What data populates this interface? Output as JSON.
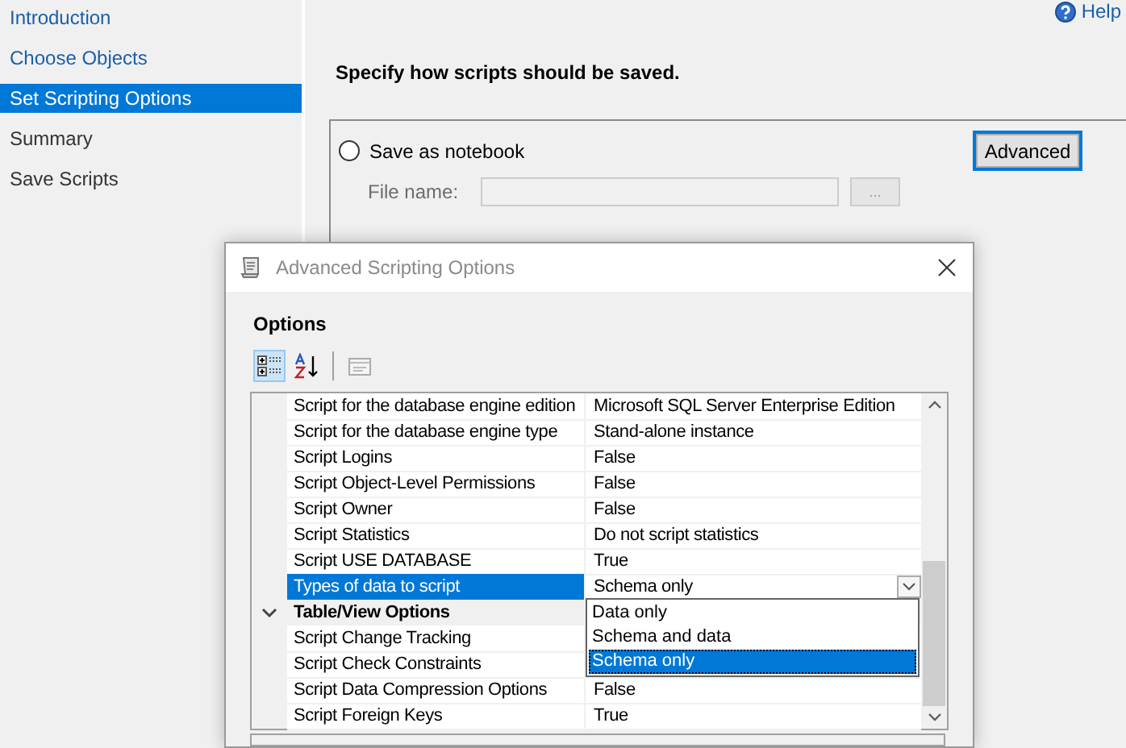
{
  "wizard": {
    "nav": [
      {
        "label": "Introduction",
        "selected": false
      },
      {
        "label": "Choose Objects",
        "selected": false
      },
      {
        "label": "Set Scripting Options",
        "selected": true
      },
      {
        "label": "Summary",
        "selected": false
      },
      {
        "label": "Save Scripts",
        "selected": false
      }
    ],
    "help": "Help",
    "heading": "Specify how scripts should be saved.",
    "save_option": {
      "label": "Save as notebook",
      "selected": false
    },
    "advanced_button": "Advanced",
    "file_name": {
      "label": "File name:",
      "disabled": true
    },
    "browse_button": {
      "label": "...",
      "disabled": true
    }
  },
  "dialog": {
    "title": "Advanced Scripting Options",
    "section": "Options",
    "toolbar": [
      {
        "kind": "categorized",
        "selected": true
      },
      {
        "kind": "alphabetical",
        "selected": false
      },
      {
        "kind": "property-pages",
        "selected": false
      }
    ],
    "rows": [
      {
        "kind": "property",
        "name": "Script for the database engine edition",
        "value": "Microsoft SQL Server Enterprise Edition",
        "selected": false
      },
      {
        "kind": "property",
        "name": "Script for the database engine type",
        "value": "Stand-alone instance",
        "selected": false
      },
      {
        "kind": "property",
        "name": "Script Logins",
        "value": "False",
        "selected": false
      },
      {
        "kind": "property",
        "name": "Script Object-Level Permissions",
        "value": "False",
        "selected": false
      },
      {
        "kind": "property",
        "name": "Script Owner",
        "value": "False",
        "selected": false
      },
      {
        "kind": "property",
        "name": "Script Statistics",
        "value": "Do not script statistics",
        "selected": false
      },
      {
        "kind": "property",
        "name": "Script USE DATABASE",
        "value": "True",
        "selected": false
      },
      {
        "kind": "property",
        "name": "Types of data to script",
        "value": "Schema only",
        "selected": true
      },
      {
        "kind": "category",
        "name": "Table/View Options",
        "expanded": true
      },
      {
        "kind": "property",
        "name": "Script Change Tracking",
        "selected": false
      },
      {
        "kind": "property",
        "name": "Script Check Constraints",
        "selected": false
      },
      {
        "kind": "property",
        "name": "Script Data Compression Options",
        "value": "False",
        "selected": false
      },
      {
        "kind": "property",
        "name": "Script Foreign Keys",
        "value": "True",
        "selected": false
      }
    ],
    "dropdown": [
      {
        "label": "Data only",
        "selected": false
      },
      {
        "label": "Schema and data",
        "selected": false
      },
      {
        "label": "Schema only",
        "selected": true
      }
    ]
  }
}
